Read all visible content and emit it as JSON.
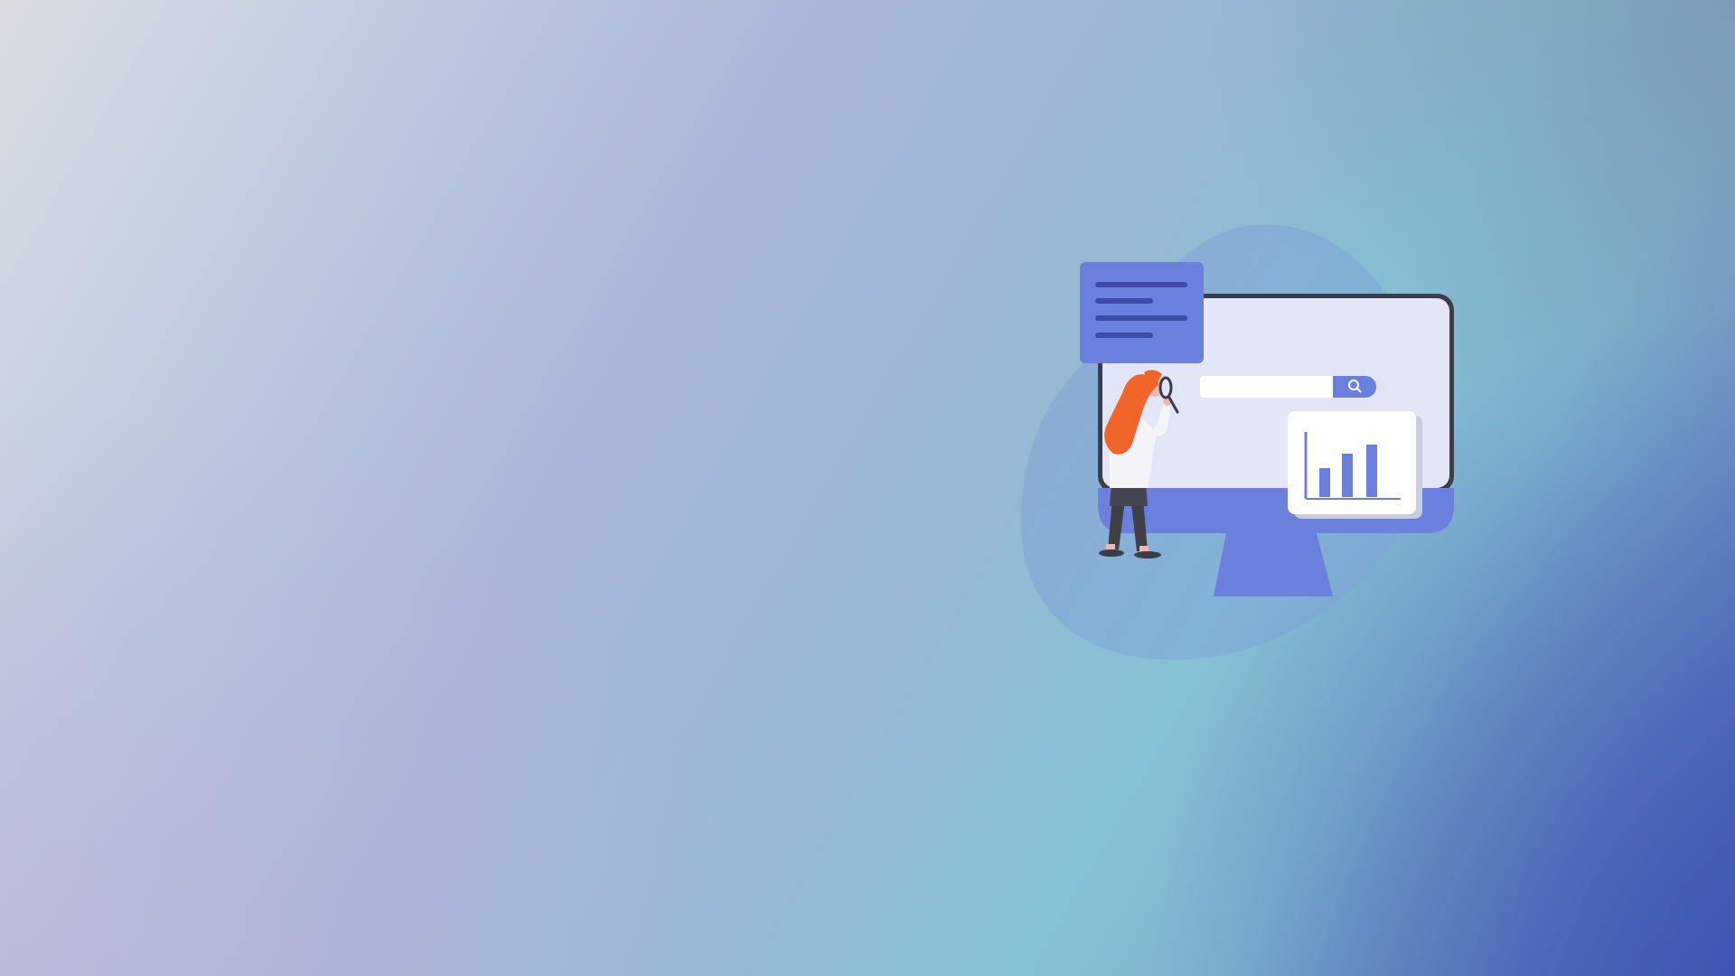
{
  "scene": {
    "illustration": "person-searching-monitor-illustration",
    "icons": [
      "document-icon",
      "search-icon",
      "bar-chart-icon",
      "magnifying-glass-icon"
    ],
    "colors": {
      "accent": "#6b7fdc",
      "screen": "#e3e6f7",
      "monitor_frame": "#3a3d4a",
      "hair": "#f2652a"
    },
    "search": {
      "placeholder": ""
    }
  }
}
